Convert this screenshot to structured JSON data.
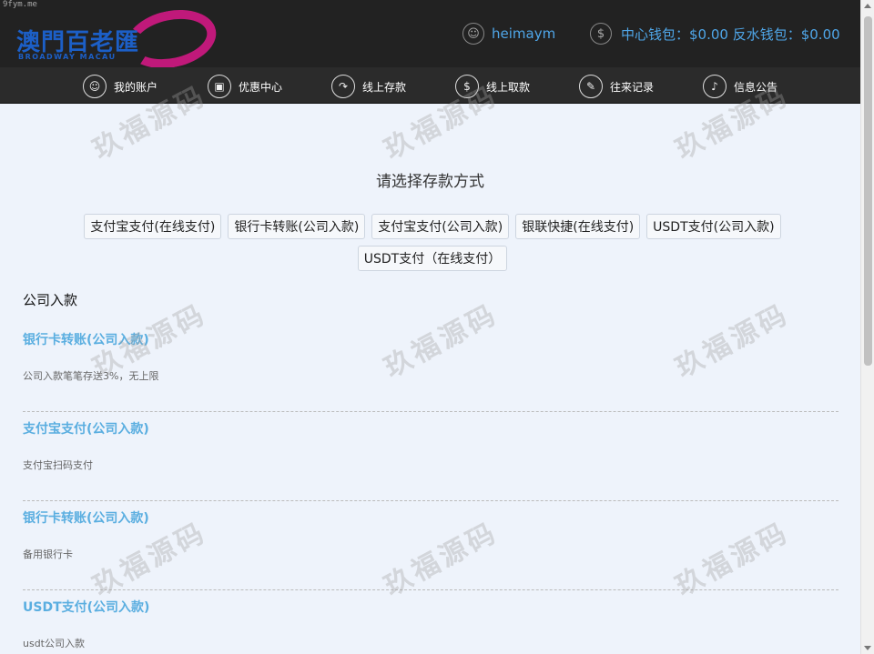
{
  "site_tag": "9fym.me",
  "header": {
    "logo_cn": "澳門百老匯",
    "logo_en": "BROADWAY MACAU",
    "username": "heimaym",
    "wallet_text": "中心钱包：$0.00 反水钱包：$0.00"
  },
  "nav": [
    {
      "label": "我的账户",
      "icon": "user-icon"
    },
    {
      "label": "优惠中心",
      "icon": "gift-icon"
    },
    {
      "label": "线上存款",
      "icon": "deposit-icon"
    },
    {
      "label": "线上取款",
      "icon": "withdraw-icon"
    },
    {
      "label": "往来记录",
      "icon": "record-icon"
    },
    {
      "label": "信息公告",
      "icon": "bell-icon"
    }
  ],
  "page": {
    "title": "请选择存款方式",
    "methods": [
      "支付宝支付(在线支付)",
      "银行卡转账(公司入款)",
      "支付宝支付(公司入款)",
      "银联快捷(在线支付)",
      "USDT支付(公司入款)",
      "USDT支付（在线支付）"
    ],
    "section_title": "公司入款",
    "items": [
      {
        "title": "银行卡转账(公司入款)",
        "desc": "公司入款笔笔存送3%，无上限"
      },
      {
        "title": "支付宝支付(公司入款)",
        "desc": "支付宝扫码支付"
      },
      {
        "title": "银行卡转账(公司入款)",
        "desc": "备用银行卡"
      },
      {
        "title": "USDT支付(公司入款)",
        "desc": "usdt公司入款"
      }
    ]
  },
  "watermark": "玖福源码"
}
